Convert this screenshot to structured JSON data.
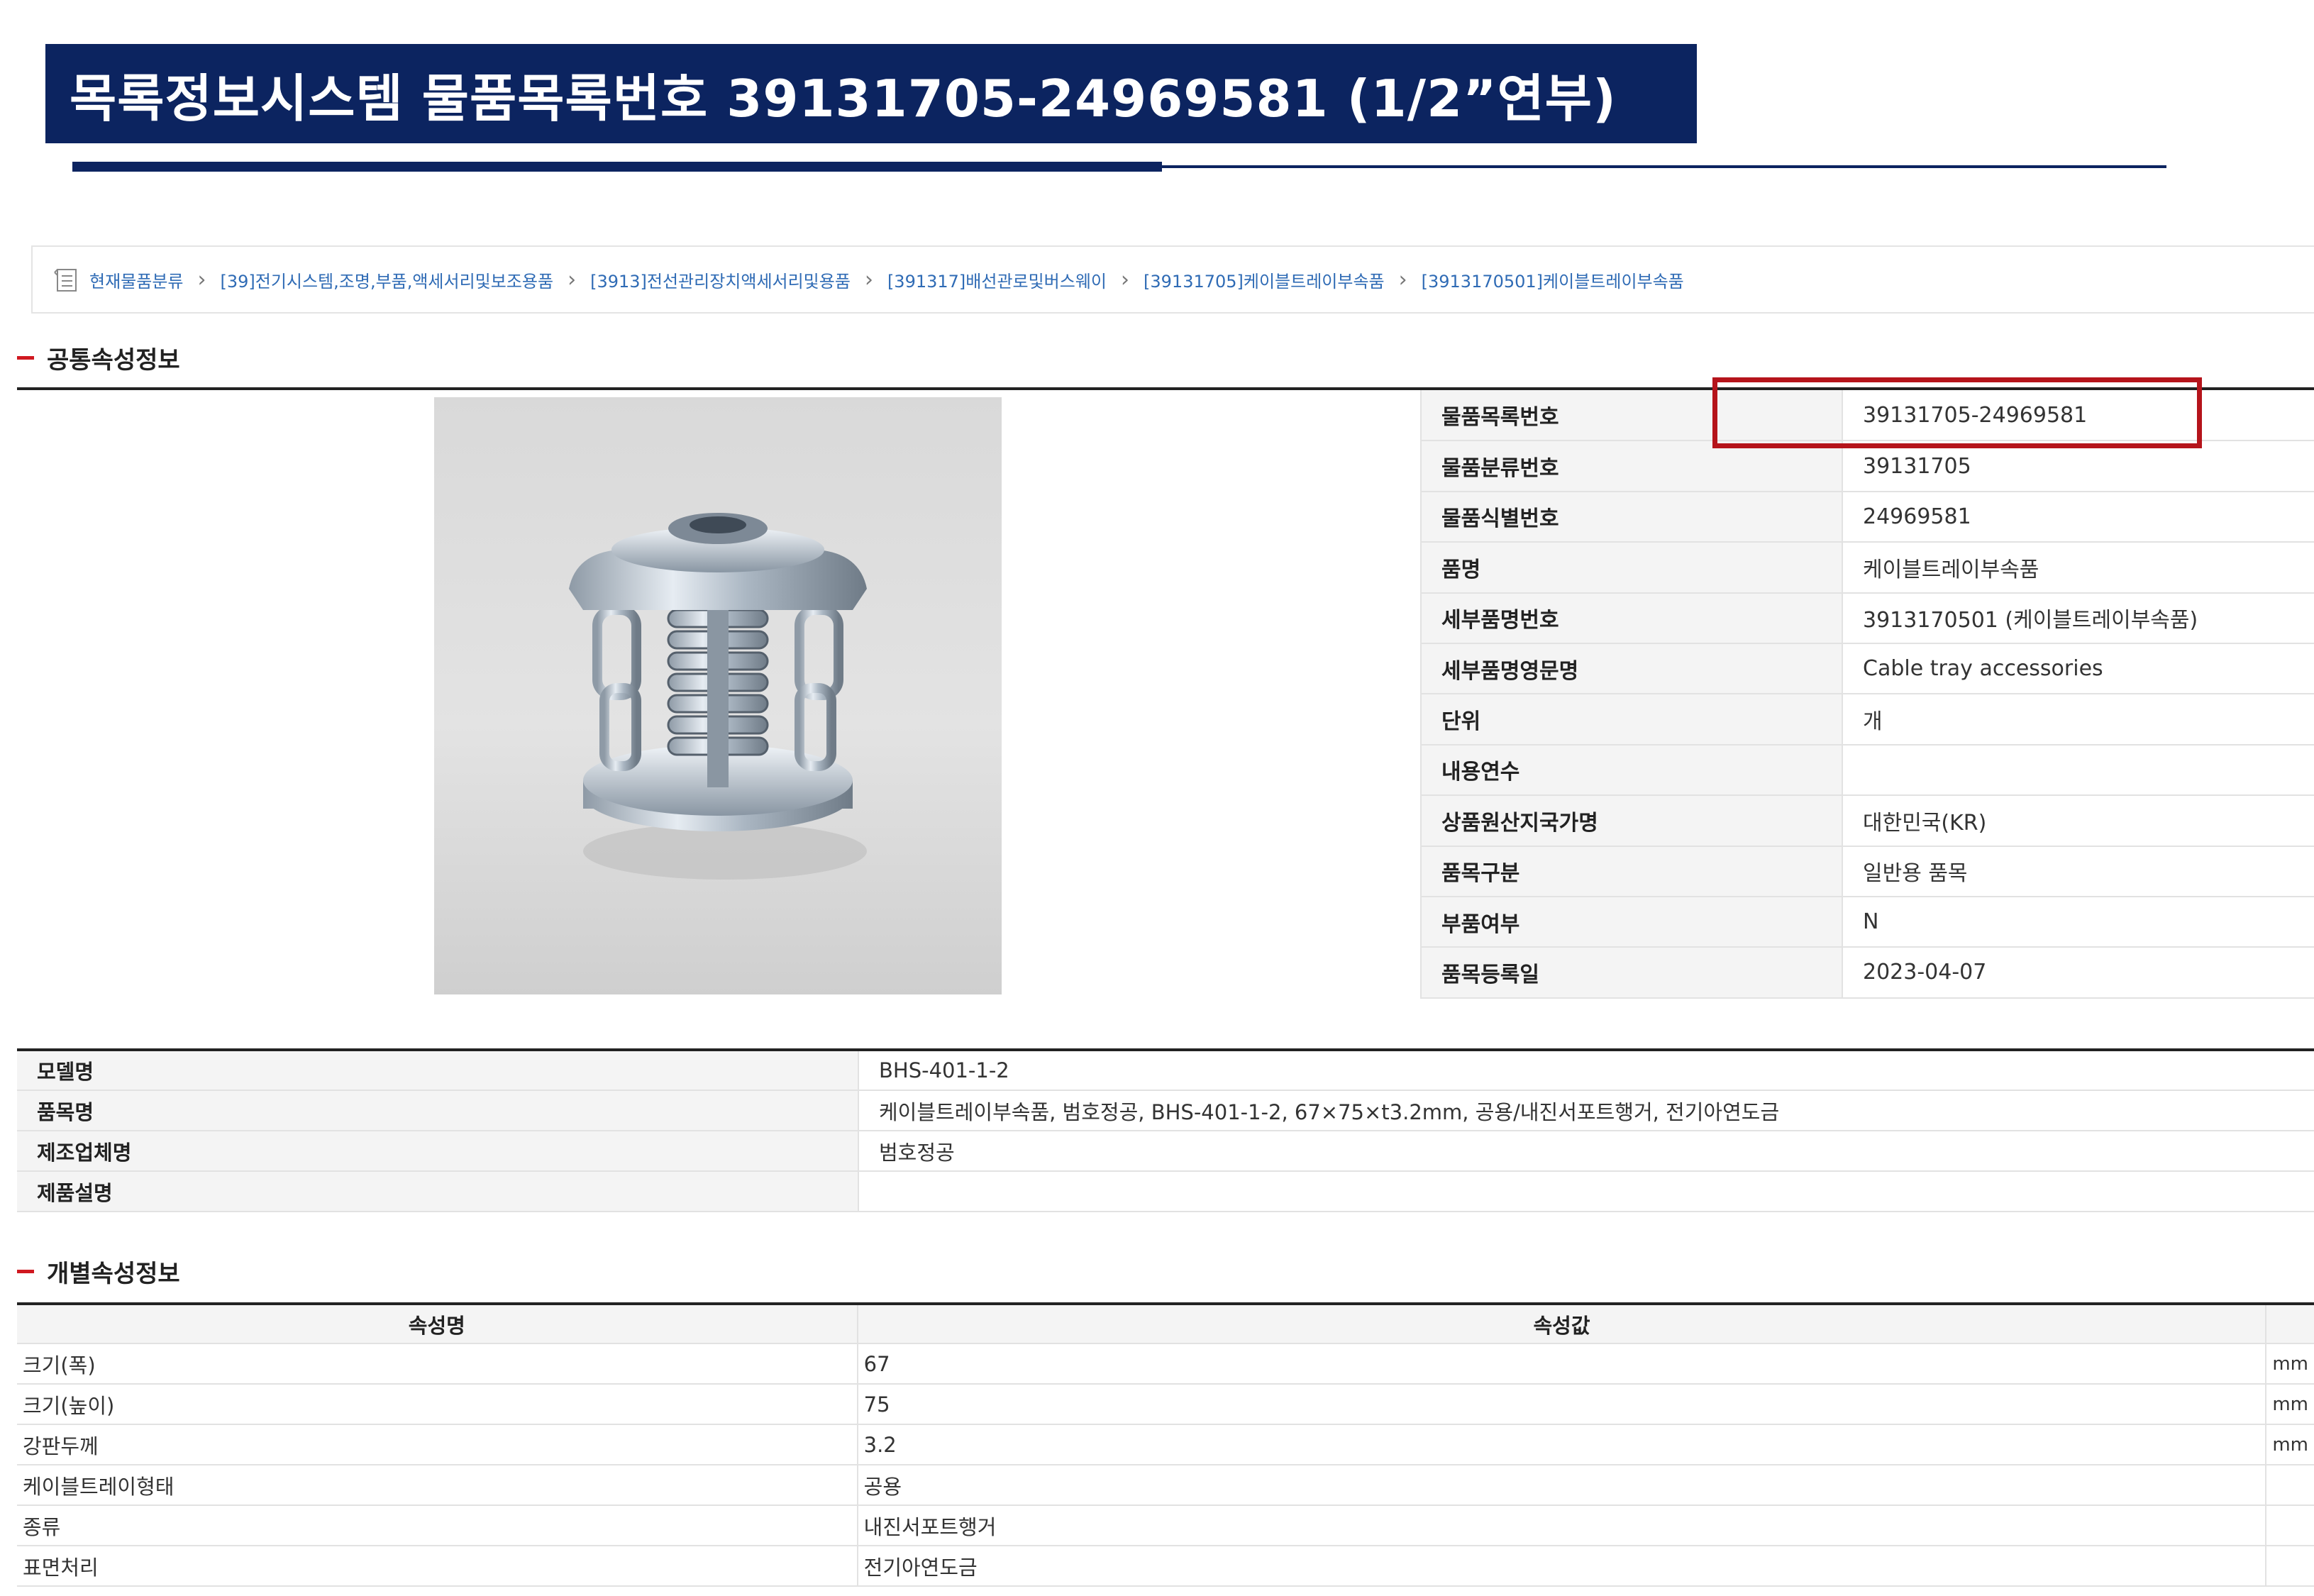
{
  "header": {
    "title": "목록정보시스템 물품목록번호 39131705-24969581 (1/2”연부)"
  },
  "breadcrumb": {
    "home": "현재물품분류",
    "items": [
      "[39]전기시스템,조명,부품,액세서리및보조용품",
      "[3913]전선관리장치액세서리및용품",
      "[391317]배선관로및버스웨이",
      "[39131705]케이블트레이부속품",
      "[3913170501]케이블트레이부속품"
    ]
  },
  "common_section": {
    "title": "공통속성정보"
  },
  "info": [
    {
      "label": "물품목록번호",
      "value": "39131705-24969581"
    },
    {
      "label": "물품분류번호",
      "value": "39131705"
    },
    {
      "label": "물품식별번호",
      "value": "24969581"
    },
    {
      "label": "품명",
      "value": "케이블트레이부속품"
    },
    {
      "label": "세부품명번호",
      "value": "3913170501 (케이블트레이부속품)"
    },
    {
      "label": "세부품명영문명",
      "value": "Cable tray accessories"
    },
    {
      "label": "단위",
      "value": "개"
    },
    {
      "label": "내용연수",
      "value": ""
    },
    {
      "label": "상품원산지국가명",
      "value": "대한민국(KR)"
    },
    {
      "label": "품목구분",
      "value": "일반용 품목"
    },
    {
      "label": "부품여부",
      "value": "N"
    },
    {
      "label": "품목등록일",
      "value": "2023-04-07"
    }
  ],
  "model": [
    {
      "label": "모델명",
      "value": "BHS-401-1-2"
    },
    {
      "label": "품목명",
      "value": "케이블트레이부속품, 범호정공, BHS-401-1-2, 67×75×t3.2mm, 공용/내진서포트행거, 전기아연도금"
    },
    {
      "label": "제조업체명",
      "value": "범호정공"
    },
    {
      "label": "제품설명",
      "value": ""
    }
  ],
  "attr_section": {
    "title": "개별속성정보",
    "col_name": "속성명",
    "col_value": "속성값"
  },
  "attributes": [
    {
      "name": "크기(폭)",
      "value": "67",
      "unit": "mm"
    },
    {
      "name": "크기(높이)",
      "value": "75",
      "unit": "mm"
    },
    {
      "name": "강판두께",
      "value": "3.2",
      "unit": "mm"
    },
    {
      "name": "케이블트레이형태",
      "value": "공용",
      "unit": ""
    },
    {
      "name": "종류",
      "value": "내진서포트행거",
      "unit": ""
    },
    {
      "name": "표면처리",
      "value": "전기아연도금",
      "unit": ""
    }
  ],
  "colors": {
    "title_bg": "#0c2460",
    "link": "#2f6bb5",
    "highlight": "#b5141b",
    "section_dash": "#d01820"
  }
}
